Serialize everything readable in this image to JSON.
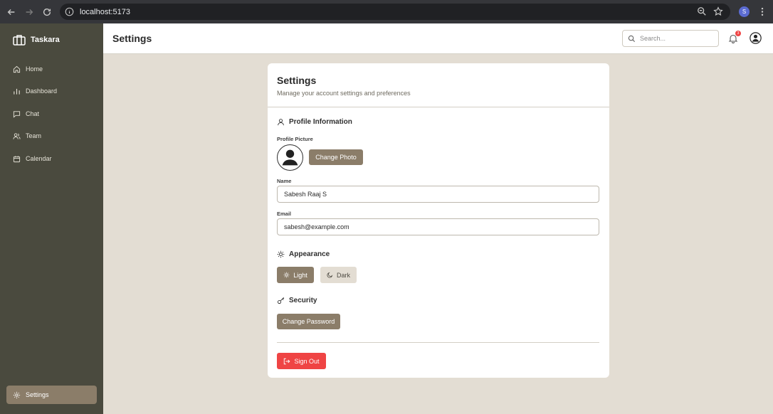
{
  "browser": {
    "url": "localhost:5173",
    "profile_initial": "S"
  },
  "sidebar": {
    "brand": "Taskara",
    "items": [
      {
        "label": "Home",
        "icon": "home-icon"
      },
      {
        "label": "Dashboard",
        "icon": "bar-chart-icon"
      },
      {
        "label": "Chat",
        "icon": "chat-icon"
      },
      {
        "label": "Team",
        "icon": "users-icon"
      },
      {
        "label": "Calendar",
        "icon": "calendar-icon"
      }
    ],
    "settings_label": "Settings"
  },
  "header": {
    "title": "Settings",
    "search_placeholder": "Search...",
    "notification_count": "3"
  },
  "settings": {
    "title": "Settings",
    "subtitle": "Manage your account settings and preferences",
    "profile": {
      "heading": "Profile Information",
      "picture_label": "Profile Picture",
      "change_photo": "Change Photo",
      "name_label": "Name",
      "name_value": "Sabesh Raaj S",
      "email_label": "Email",
      "email_value": "sabesh@example.com"
    },
    "appearance": {
      "heading": "Appearance",
      "light": "Light",
      "dark": "Dark",
      "selected": "Light"
    },
    "security": {
      "heading": "Security",
      "change_password": "Change Password"
    },
    "sign_out": "Sign Out"
  },
  "colors": {
    "sidebar_bg": "#4a4a3e",
    "accent": "#8b7d69",
    "page_bg": "#e3ddd3",
    "danger": "#ef4444"
  }
}
